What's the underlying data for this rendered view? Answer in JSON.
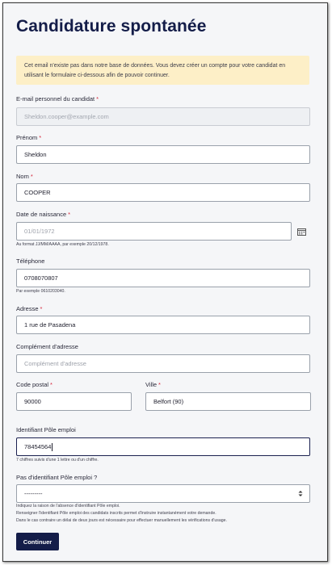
{
  "page": {
    "title": "Candidature spontanée"
  },
  "alert": {
    "text": "Cet email n'existe pas dans notre base de données. Vous devez créer un compte pour votre candidat en utilisant le formulaire ci-dessous afin de pouvoir continuer."
  },
  "form": {
    "required_mark": "*",
    "email": {
      "label": "E-mail personnel du candidat",
      "value": "Sheldon.cooper@example.com"
    },
    "prenom": {
      "label": "Prénom",
      "value": "Sheldon"
    },
    "nom": {
      "label": "Nom",
      "value": "COOPER"
    },
    "naissance": {
      "label": "Date de naissance",
      "value": "01/01/1972",
      "hint": "Au format JJ/MM/AAAA, par exemple 20/12/1978."
    },
    "telephone": {
      "label": "Téléphone",
      "value": "0708070807",
      "hint": "Par exemple 0610203040."
    },
    "adresse": {
      "label": "Adresse",
      "value": "1 rue de Pasadena"
    },
    "complement": {
      "label": "Complément d'adresse",
      "placeholder": "Complément d'adresse"
    },
    "code_postal": {
      "label": "Code postal",
      "value": "90000"
    },
    "ville": {
      "label": "Ville",
      "value": "Belfort (90)"
    },
    "pole_emploi_id": {
      "label": "Identifiant Pôle emploi",
      "value": "78454564",
      "hint": "7 chiffres suivis d'une 1 lettre ou d'un chiffre."
    },
    "pas_identifiant": {
      "label": "Pas d'identifiant Pôle emploi ?",
      "selected": "---------",
      "hint_lines": [
        "Indiquez la raison de l'absence d'identifiant Pôle emploi.",
        "Renseigner l'identifiant Pôle emploi des candidats inscrits permet d'instruire instantanément votre demande.",
        "Dans le cas contraire un délai de deux jours est nécessaire pour effectuer manuellement les vérifications d'usage."
      ]
    },
    "submit_label": "Continuer"
  }
}
